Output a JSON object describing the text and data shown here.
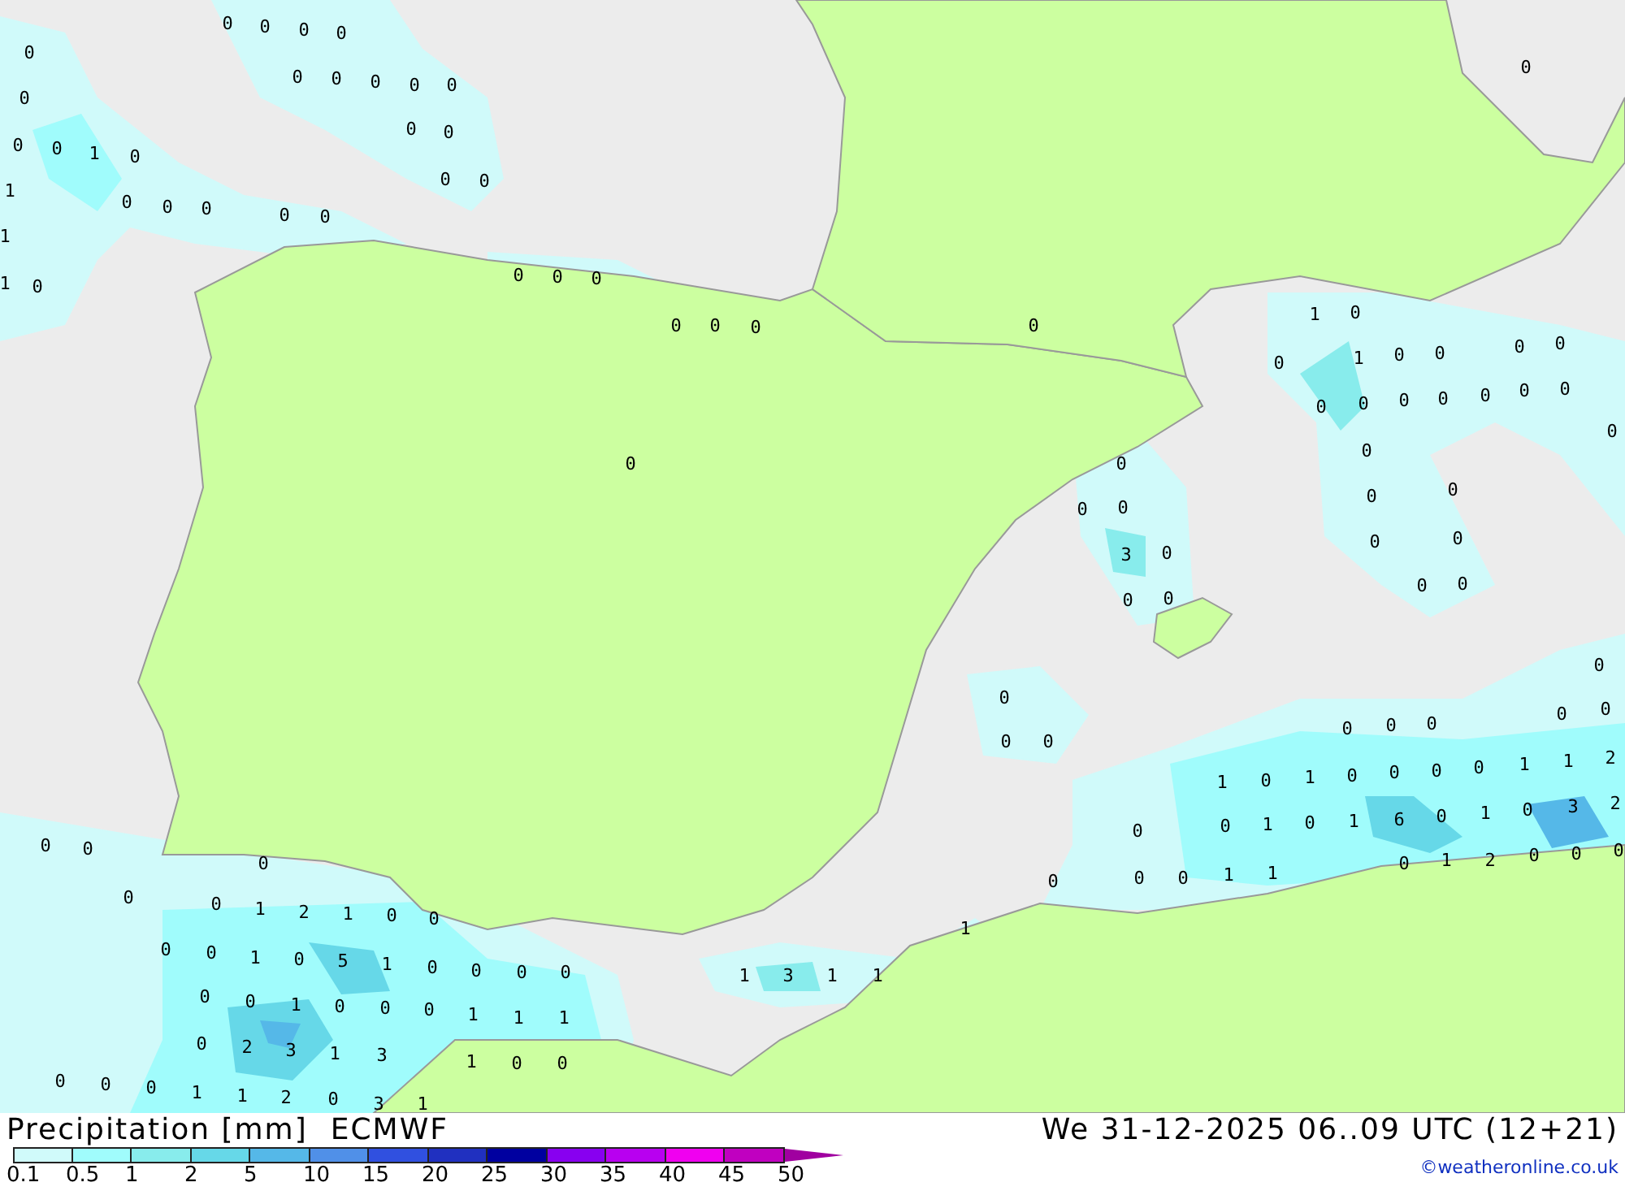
{
  "map": {
    "value_labels": [
      "0",
      "0",
      "0",
      "0",
      "1",
      "0",
      "1",
      "1",
      "1",
      "0",
      "0",
      "0",
      "0",
      "0",
      "0",
      "0",
      "0",
      "0",
      "0",
      "0",
      "0",
      "0",
      "0",
      "0",
      "0",
      "0",
      "0",
      "0",
      "0",
      "0",
      "0",
      "0",
      "0",
      "0",
      "0",
      "0",
      "0",
      "1",
      "0",
      "0",
      "1",
      "0",
      "0",
      "0",
      "0",
      "0",
      "0",
      "0",
      "0",
      "0",
      "0",
      "0",
      "0",
      "0",
      "0",
      "0",
      "0",
      "0",
      "0",
      "0",
      "0",
      "0",
      "0",
      "3",
      "0",
      "0",
      "0",
      "0",
      "0",
      "0",
      "0",
      "0",
      "0",
      "0",
      "0",
      "0",
      "1",
      "0",
      "1",
      "0",
      "0",
      "0",
      "0",
      "1",
      "1",
      "2",
      "0",
      "0",
      "1",
      "0",
      "1",
      "6",
      "0",
      "1",
      "0",
      "3",
      "2",
      "0",
      "1",
      "2",
      "0",
      "0",
      "0",
      "0",
      "0",
      "0",
      "1",
      "1",
      "0",
      "0",
      "0",
      "0",
      "0",
      "1",
      "2",
      "1",
      "0",
      "0",
      "0",
      "0",
      "1",
      "0",
      "5",
      "1",
      "0",
      "0",
      "0",
      "0",
      "0",
      "0",
      "1",
      "0",
      "0",
      "0",
      "1",
      "1",
      "1",
      "0",
      "2",
      "3",
      "1",
      "3",
      "1",
      "0",
      "0",
      "0",
      "0",
      "0",
      "1",
      "1",
      "2",
      "0",
      "3",
      "1",
      "1",
      "3",
      "1",
      "1",
      "1"
    ]
  },
  "legend": {
    "title": "Precipitation [mm]",
    "model": "ECMWF",
    "valid_time": "We 31-12-2025 06..09 UTC (12+21)",
    "scale": [
      {
        "color": "#d0fafa"
      },
      {
        "color": "#a0fcfc"
      },
      {
        "color": "#88ecec"
      },
      {
        "color": "#66d8e8"
      },
      {
        "color": "#55b8e8"
      },
      {
        "color": "#5090e8"
      },
      {
        "color": "#3050e0"
      },
      {
        "color": "#2030c0"
      },
      {
        "color": "#0000a0"
      },
      {
        "color": "#8800f0"
      },
      {
        "color": "#b800f0"
      },
      {
        "color": "#f000f0"
      },
      {
        "color": "#c000c0"
      }
    ],
    "ticks": [
      "0.1",
      "0.5",
      "1",
      "2",
      "5",
      "10",
      "15",
      "20",
      "25",
      "30",
      "35",
      "40",
      "45",
      "50"
    ],
    "credit": "©weatheronline.co.uk"
  }
}
